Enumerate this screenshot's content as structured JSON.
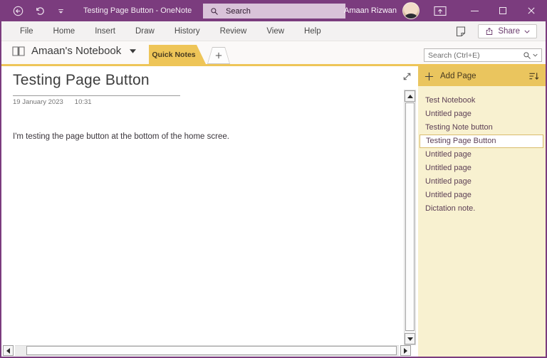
{
  "titlebar": {
    "title": "Testing Page Button  -  OneNote",
    "search_placeholder": "Search",
    "user_name": "Amaan Rizwan"
  },
  "menubar": {
    "items": [
      "File",
      "Home",
      "Insert",
      "Draw",
      "History",
      "Review",
      "View",
      "Help"
    ],
    "share_label": "Share"
  },
  "notebook_bar": {
    "notebook_name": "Amaan's Notebook",
    "active_tab": "Quick Notes",
    "search_placeholder": "Search (Ctrl+E)"
  },
  "page": {
    "title": "Testing Page Button",
    "date": "19 January 2023",
    "time": "10:31",
    "body": "I'm testing the page button at the bottom of the home scree."
  },
  "sidebar": {
    "add_page_label": "Add Page",
    "pages": [
      {
        "label": "Test Notebook",
        "selected": false
      },
      {
        "label": "Untitled page",
        "selected": false
      },
      {
        "label": "Testing Note button",
        "selected": false
      },
      {
        "label": "Testing Page Button",
        "selected": true
      },
      {
        "label": "Untitled page",
        "selected": false
      },
      {
        "label": "Untitled page",
        "selected": false
      },
      {
        "label": "Untitled page",
        "selected": false
      },
      {
        "label": "Untitled page",
        "selected": false
      },
      {
        "label": "Dictation note.",
        "selected": false
      }
    ]
  },
  "colors": {
    "accent_purple": "#7b3c7e",
    "titlebar_search_bg": "#d9c3d9",
    "tab_gold": "#eec558",
    "sidebar_bg": "#f8f1d0",
    "sidebar_header_gold": "#eac55e",
    "selected_page_bg": "#ffffff"
  }
}
